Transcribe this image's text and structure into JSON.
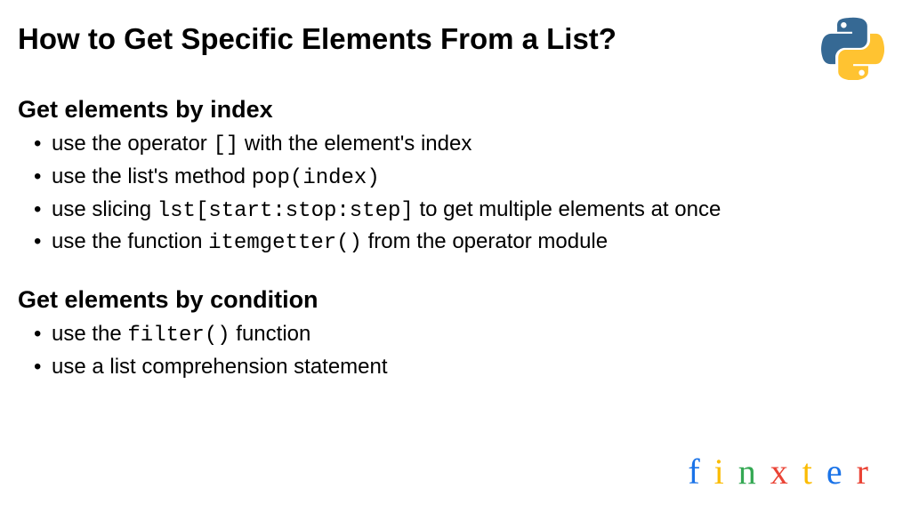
{
  "title": "How to Get Specific Elements From a List?",
  "sections": [
    {
      "heading": "Get elements by index",
      "items": [
        {
          "pre": "use the operator ",
          "code": "[]",
          "post": " with the element's index"
        },
        {
          "pre": "use the list's method ",
          "code": "pop(index)",
          "post": ""
        },
        {
          "pre": "use slicing ",
          "code": "lst[start:stop:step]",
          "post": " to get multiple elements at once"
        },
        {
          "pre": "use the function ",
          "code": "itemgetter()",
          "post": " from the operator module"
        }
      ]
    },
    {
      "heading": "Get elements by condition",
      "items": [
        {
          "pre": "use the ",
          "code": "filter()",
          "post": " function"
        },
        {
          "pre": "use a list comprehension statement",
          "code": "",
          "post": ""
        }
      ]
    }
  ],
  "brand": {
    "letters": [
      "f",
      "i",
      "n",
      "x",
      "t",
      "e",
      "r"
    ]
  }
}
